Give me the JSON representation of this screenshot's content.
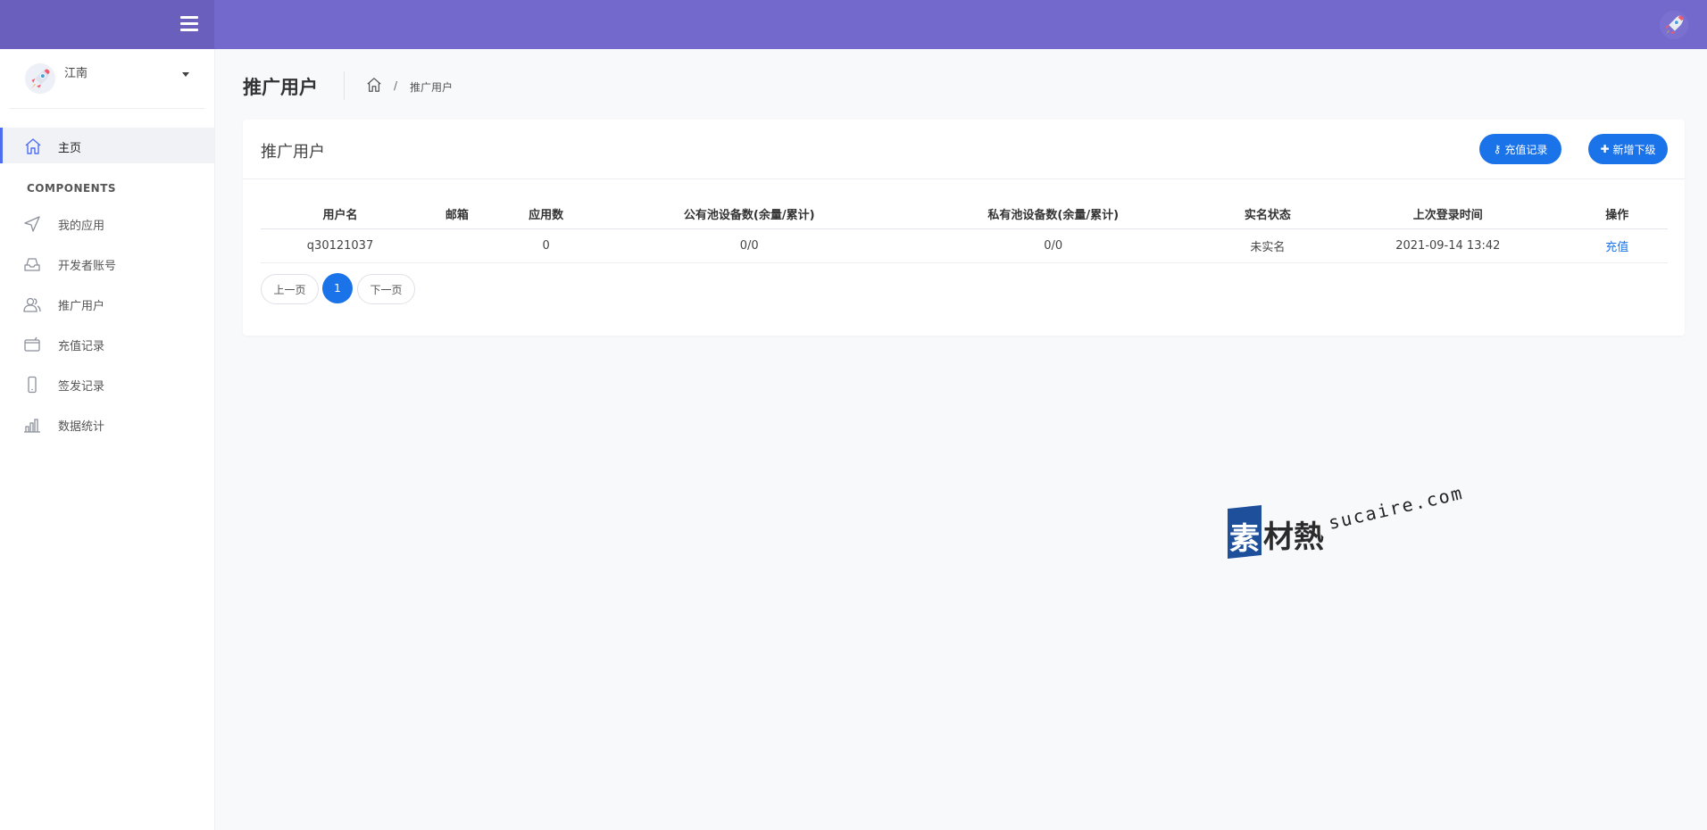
{
  "header": {
    "menu_icon": "hamburger-icon",
    "logo_icon": "rocket-icon"
  },
  "sidebar": {
    "profile": {
      "name": "江南",
      "avatar_icon": "rocket-icon"
    },
    "home": {
      "label": "主页",
      "icon": "home-icon"
    },
    "section_label": "COMPONENTS",
    "items": [
      {
        "label": "我的应用",
        "icon": "send-icon"
      },
      {
        "label": "开发者账号",
        "icon": "inbox-icon"
      },
      {
        "label": "推广用户",
        "icon": "users-icon"
      },
      {
        "label": "充值记录",
        "icon": "wallet-icon"
      },
      {
        "label": "签发记录",
        "icon": "mobile-icon"
      },
      {
        "label": "数据统计",
        "icon": "bar-chart-icon"
      }
    ]
  },
  "page": {
    "title": "推广用户",
    "breadcrumb": {
      "separator": "/",
      "current": "推广用户"
    }
  },
  "card": {
    "title": "推广用户",
    "recharge_button": "充值记录",
    "add_button": "新增下级",
    "table": {
      "columns": [
        "用户名",
        "邮箱",
        "应用数",
        "公有池设备数(余量/累计)",
        "私有池设备数(余量/累计)",
        "实名状态",
        "上次登录时间",
        "操作"
      ],
      "rows": [
        {
          "username": "q30121037",
          "email": "",
          "apps": "0",
          "public_pool": "0/0",
          "private_pool": "0/0",
          "verify_status": "未实名",
          "last_login": "2021-09-14 13:42",
          "action": "充值"
        }
      ]
    },
    "pagination": {
      "prev": "上一页",
      "current": "1",
      "next": "下一页"
    }
  },
  "watermark": {
    "brand_first": "素",
    "brand_rest": "材熱",
    "url": "sucaire.com"
  },
  "colors": {
    "header": "#7369cc",
    "sidebar_header": "#6a5fbd",
    "accent": "#1a73e8",
    "active_border": "#4e6ef2"
  }
}
